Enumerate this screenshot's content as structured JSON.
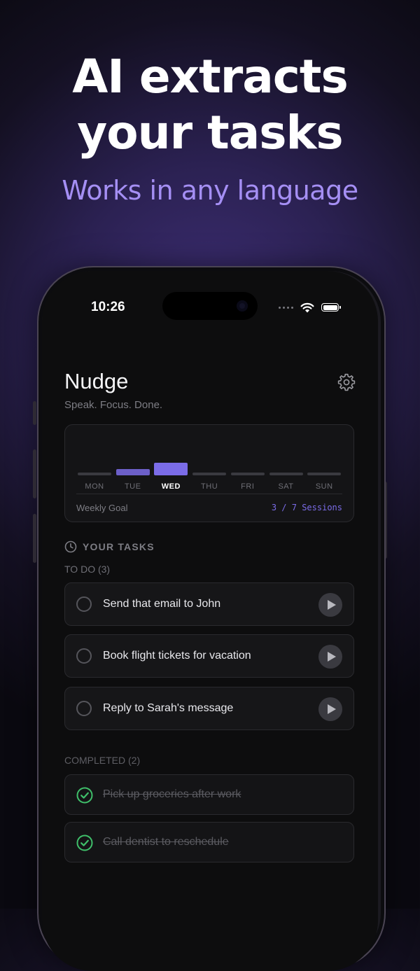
{
  "promo": {
    "headline_line1": "AI extracts",
    "headline_line2": "your tasks",
    "subheadline": "Works in any language"
  },
  "status_bar": {
    "time": "10:26"
  },
  "app": {
    "title": "Nudge",
    "tagline": "Speak. Focus. Done."
  },
  "weekly": {
    "days": [
      {
        "label": "MON",
        "sessions_level": 0
      },
      {
        "label": "TUE",
        "sessions_level": 1
      },
      {
        "label": "WED",
        "sessions_level": 2,
        "active": true
      },
      {
        "label": "THU",
        "sessions_level": 0
      },
      {
        "label": "FRI",
        "sessions_level": 0
      },
      {
        "label": "SAT",
        "sessions_level": 0
      },
      {
        "label": "SUN",
        "sessions_level": 0
      }
    ],
    "goal_label": "Weekly Goal",
    "goal_value": "3 / 7 Sessions"
  },
  "tasks": {
    "section_title": "YOUR TASKS",
    "todo_label": "TO DO (3)",
    "todo": [
      {
        "text": "Send that email to John"
      },
      {
        "text": "Book flight tickets for vacation"
      },
      {
        "text": "Reply to Sarah's message"
      }
    ],
    "completed_label": "COMPLETED (2)",
    "completed": [
      {
        "text": "Pick up groceries after work"
      },
      {
        "text": "Call dentist to reschedule"
      }
    ]
  },
  "colors": {
    "accent": "#7b6ce8",
    "subhead": "#a58ff4",
    "check_green": "#3fbf6a",
    "background": "#0d0d0e"
  }
}
